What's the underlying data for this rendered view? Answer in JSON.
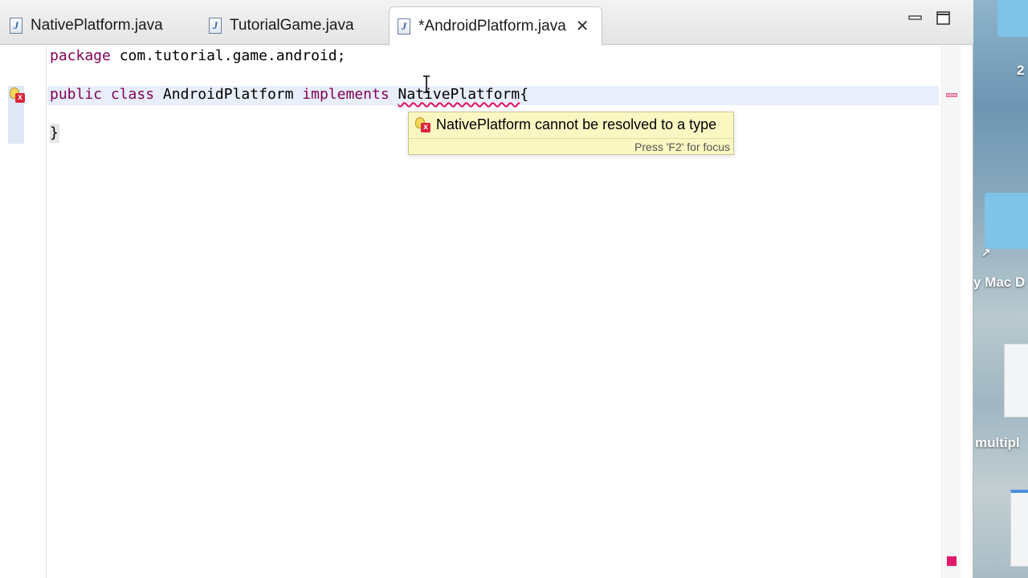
{
  "tabs": [
    {
      "label": "NativePlatform.java",
      "active": false
    },
    {
      "label": "TutorialGame.java",
      "active": false
    },
    {
      "label": "*AndroidPlatform.java",
      "active": true
    }
  ],
  "code": {
    "line1": {
      "kw": "package",
      "rest": " com.tutorial.game.android;"
    },
    "line3": {
      "kw1": "public",
      "kw2": "class",
      "name": " AndroidPlatform ",
      "kw3": "implements",
      "type": "NativePlatform",
      "brace": "{"
    },
    "line5": "}"
  },
  "hover": {
    "message": "NativePlatform cannot be resolved to a type",
    "footer": "Press 'F2' for focus"
  },
  "desktop": {
    "label_number": "2",
    "label_mac": "y Mac D",
    "label_multi": "multipl"
  },
  "colors": {
    "keyword": "#7f0055",
    "error": "#e0115f",
    "tooltip_bg": "#fbf7c3",
    "line_highlight": "#e8eefa"
  },
  "icons": [
    "java-file-icon",
    "close-icon",
    "minimize-icon",
    "maximize-icon",
    "error-quickfix-icon"
  ]
}
